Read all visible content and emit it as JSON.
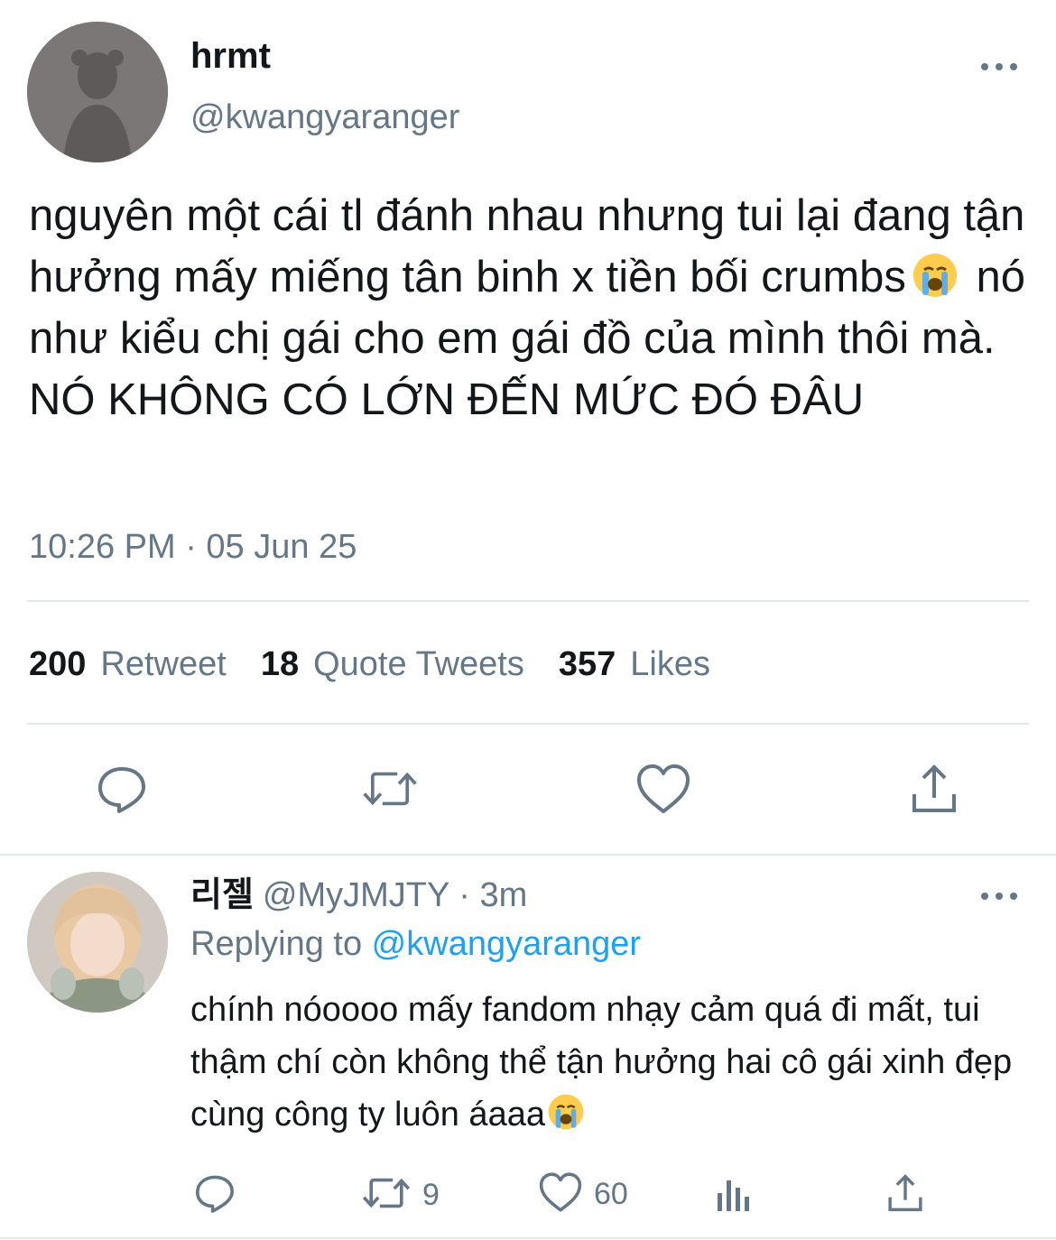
{
  "tweet": {
    "display_name": "hrmt",
    "handle": "@kwangyaranger",
    "text_part1": "nguyên một cái tl đánh nhau nhưng tui lại đang tận hưởng mấy miếng tân binh x tiền bối crumbs",
    "emoji_icon": "loudly-crying-face-icon",
    "text_part2": " nó như kiểu chị gái cho em gái đồ của mình thôi mà. NÓ KHÔNG CÓ LỚN ĐẾN MỨC ĐÓ ĐÂU",
    "timestamp": "10:26 PM · 05 Jun 25",
    "stats": {
      "retweets_count": "200",
      "retweets_label": "Retweet",
      "quotes_count": "18",
      "quotes_label": "Quote Tweets",
      "likes_count": "357",
      "likes_label": "Likes"
    },
    "actions": [
      "reply-icon",
      "retweet-icon",
      "like-icon",
      "share-icon"
    ]
  },
  "reply": {
    "display_name": "리젤",
    "handle_time": "@MyJMJTY · 3m",
    "replying_prefix": "Replying to ",
    "replying_to": "@kwangyaranger",
    "text": "chính nóoooo mấy fandom nhạy cảm quá đi mất, tui thậm chí còn không thể tận hưởng hai cô gái xinh đẹp cùng công ty luôn áaaa",
    "emoji_icon": "loudly-crying-face-icon",
    "retweets": "9",
    "likes": "60",
    "actions": [
      "reply-icon",
      "retweet-icon",
      "like-icon",
      "analytics-icon",
      "share-icon"
    ]
  },
  "colors": {
    "text": "#14171a",
    "secondary": "#657786",
    "accent": "#1da1f2",
    "divider": "#e1e8ed"
  }
}
